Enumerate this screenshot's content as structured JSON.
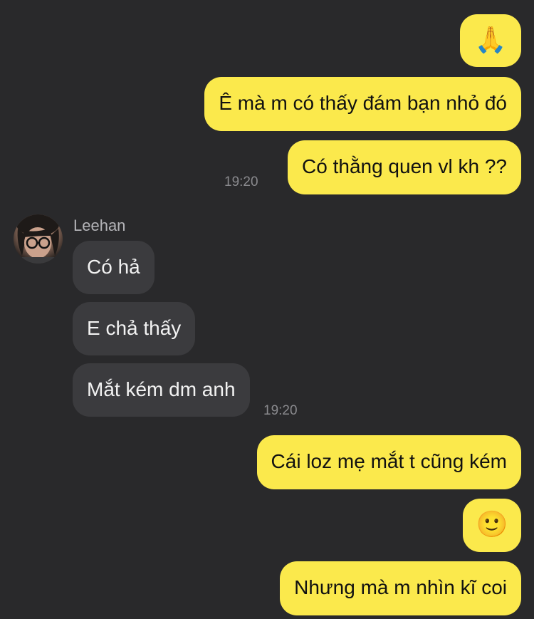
{
  "messages": {
    "out1_emoji": "🙏",
    "out2": "Ê mà m có thấy đám bạn nhỏ đó",
    "out3": "Có thằng quen vl kh ??",
    "time1": "19:20",
    "sender_name": "Leehan",
    "in1": "Có hả",
    "in2": "E chả thấy",
    "in3": "Mắt kém dm anh",
    "time2": "19:20",
    "out4": "Cái loz mẹ mắt t cũng kém",
    "out5_emoji": "🙂",
    "out6": "Nhưng mà m nhìn kĩ coi"
  },
  "colors": {
    "background": "#29292b",
    "outgoing_bubble": "#fbe94c",
    "incoming_bubble": "#3b3b3e"
  }
}
